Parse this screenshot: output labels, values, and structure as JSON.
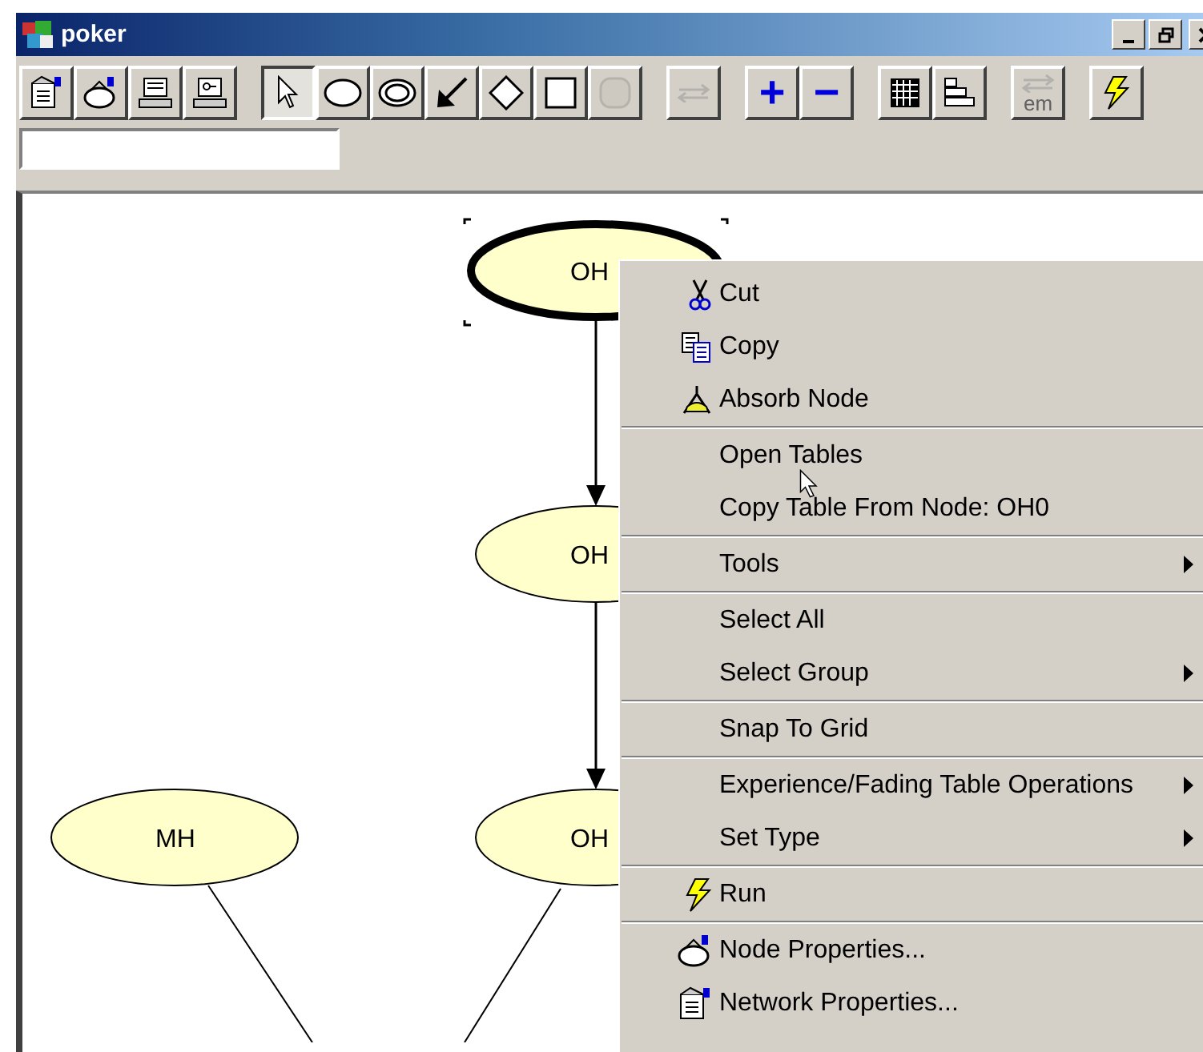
{
  "window": {
    "title": "poker"
  },
  "toolbar": {
    "groups": [
      [
        {
          "selected": false,
          "disabled": false
        },
        {
          "selected": false,
          "disabled": false
        },
        {
          "selected": false,
          "disabled": false
        },
        {
          "selected": false,
          "disabled": false
        }
      ],
      [
        {
          "selected": true,
          "disabled": false
        },
        {
          "selected": false,
          "disabled": false
        },
        {
          "selected": false,
          "disabled": false
        },
        {
          "selected": false,
          "disabled": false
        },
        {
          "selected": false,
          "disabled": false
        },
        {
          "selected": false,
          "disabled": false
        },
        {
          "selected": false,
          "disabled": true
        }
      ],
      [
        {
          "selected": false,
          "disabled": true
        }
      ],
      [
        {
          "selected": false,
          "disabled": false,
          "label": "+"
        },
        {
          "selected": false,
          "disabled": false,
          "label": "−"
        }
      ],
      [
        {
          "selected": false,
          "disabled": false
        },
        {
          "selected": false,
          "disabled": false
        }
      ],
      [
        {
          "selected": false,
          "disabled": true,
          "label": "em"
        }
      ],
      [
        {
          "selected": false,
          "disabled": false
        }
      ]
    ]
  },
  "nodes": [
    {
      "label": "OH",
      "selected": true
    },
    {
      "label": "OH",
      "selected": false
    },
    {
      "label": "MH",
      "selected": false
    },
    {
      "label": "OH",
      "selected": false
    }
  ],
  "context_menu": {
    "groups": [
      [
        {
          "label": "Cut",
          "submenu": false
        },
        {
          "label": "Copy",
          "submenu": false
        },
        {
          "label": "Absorb Node",
          "submenu": false
        }
      ],
      [
        {
          "label": "Open Tables",
          "submenu": false
        },
        {
          "label": "Copy Table From Node: OH0",
          "submenu": false
        }
      ],
      [
        {
          "label": "Tools",
          "submenu": true
        }
      ],
      [
        {
          "label": "Select All",
          "submenu": false
        },
        {
          "label": "Select Group",
          "submenu": true
        }
      ],
      [
        {
          "label": "Snap To Grid",
          "submenu": false
        }
      ],
      [
        {
          "label": "Experience/Fading Table Operations",
          "submenu": true
        },
        {
          "label": "Set Type",
          "submenu": true
        }
      ],
      [
        {
          "label": "Run",
          "submenu": false
        }
      ],
      [
        {
          "label": "Node Properties...",
          "submenu": false
        },
        {
          "label": "Network Properties...",
          "submenu": false
        }
      ]
    ]
  }
}
